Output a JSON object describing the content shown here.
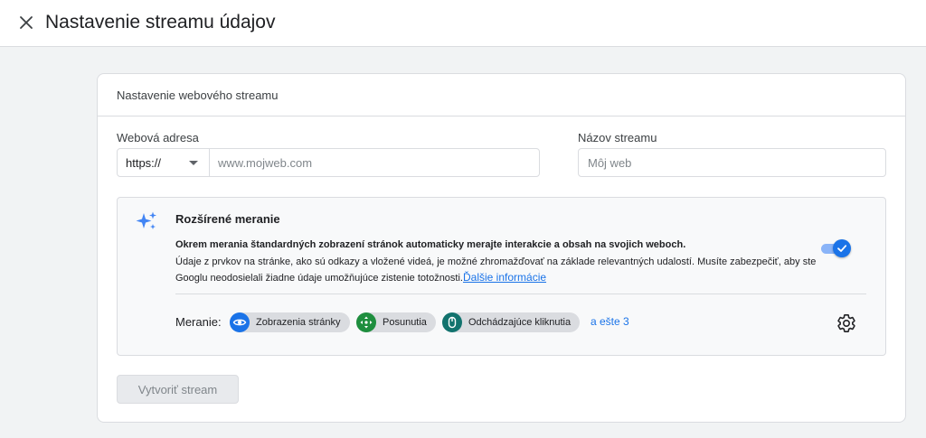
{
  "header": {
    "title": "Nastavenie streamu údajov"
  },
  "card": {
    "title": "Nastavenie webového streamu",
    "url_label": "Webová adresa",
    "protocol": "https://",
    "url_placeholder": "www.mojweb.com",
    "name_label": "Názov streamu",
    "name_placeholder": "Môj web"
  },
  "enhanced": {
    "title": "Rozšírené meranie",
    "desc_bold": "Okrem merania štandardných zobrazení stránok automaticky merajte interakcie a obsah na svojich weboch.",
    "desc": "Údaje z prvkov na stránke, ako sú odkazy a vložené videá, je možné zhromažďovať na základe relevantných udalostí. Musíte zabezpečiť, aby ste Googlu neodosielali žiadne údaje umožňujúce zistenie totožnosti.",
    "learn_more": "Ďalšie informácie",
    "toggle_on": true,
    "measuring_label": "Meranie:",
    "chips": [
      {
        "label": "Zobrazenia stránky",
        "icon": "eye-icon",
        "color": "#1a73e8"
      },
      {
        "label": "Posunutia",
        "icon": "scroll-arrows-icon",
        "color": "#1e8e3e"
      },
      {
        "label": "Odchádzajúce kliknutia",
        "icon": "mouse-icon",
        "color": "#12736e"
      }
    ],
    "more": "a ešte 3"
  },
  "actions": {
    "create": "Vytvoriť stream"
  },
  "colors": {
    "accent": "#1a73e8",
    "background": "#f1f3f4"
  }
}
